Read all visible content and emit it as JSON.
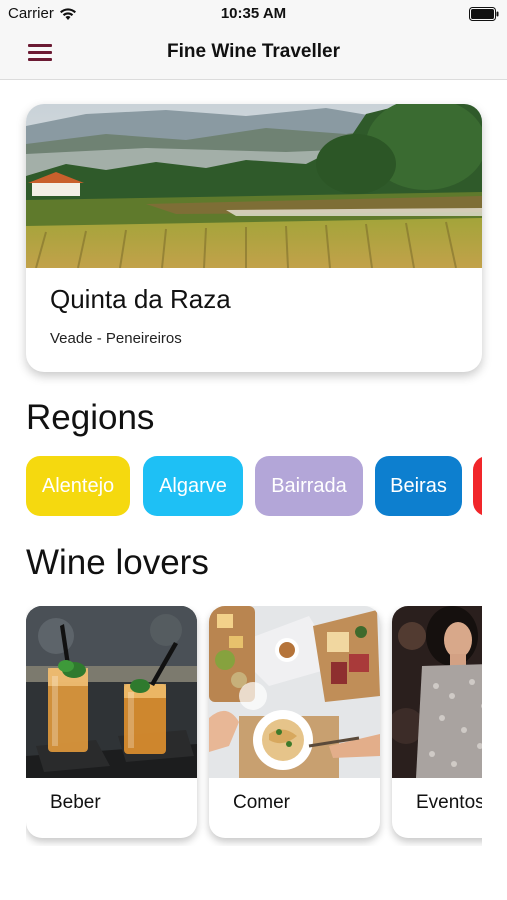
{
  "status_bar": {
    "carrier": "Carrier",
    "time": "10:35 AM",
    "icons": [
      "wifi-icon",
      "battery-icon"
    ]
  },
  "nav_bar": {
    "title": "Fine Wine Traveller",
    "menu_icon": "hamburger-menu-icon",
    "accent_color": "#6b1a33"
  },
  "featured": {
    "title": "Quinta da Raza",
    "subtitle": "Veade - Peneireiros",
    "image": "vineyard-landscape"
  },
  "regions": {
    "heading": "Regions",
    "items": [
      {
        "label": "Alentejo",
        "color": "#f5d90f"
      },
      {
        "label": "Algarve",
        "color": "#1ec0f5"
      },
      {
        "label": "Bairrada",
        "color": "#b3a6d8"
      },
      {
        "label": "Beiras",
        "color": "#0d7fcf"
      },
      {
        "label": "",
        "color": "#f1262a"
      }
    ]
  },
  "wine_lovers": {
    "heading": "Wine lovers",
    "items": [
      {
        "label": "Beber",
        "image": "cocktails-photo"
      },
      {
        "label": "Comer",
        "image": "food-platter-photo"
      },
      {
        "label": "Eventos",
        "image": "party-woman-photo"
      }
    ]
  }
}
